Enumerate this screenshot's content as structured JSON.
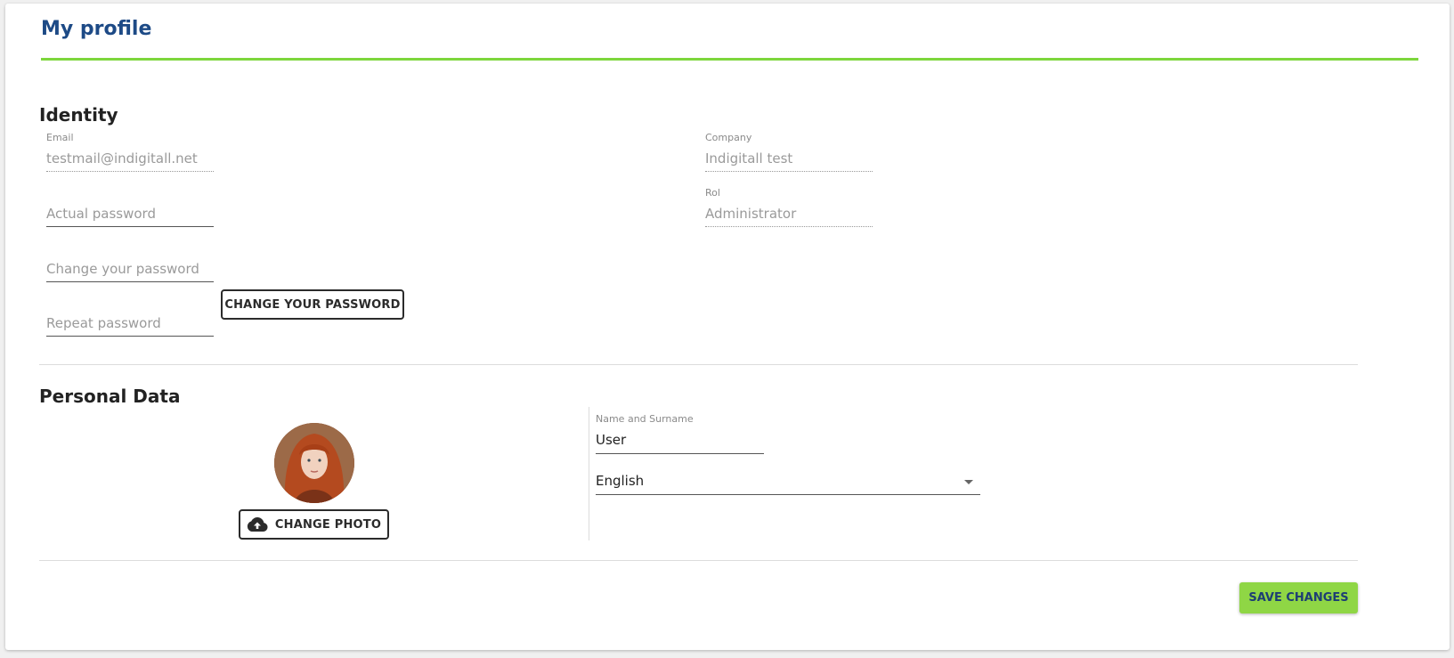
{
  "page": {
    "title": "My profile"
  },
  "identity": {
    "title": "Identity",
    "email": {
      "label": "Email",
      "value": "testmail@indigitall.net"
    },
    "actual_password": {
      "placeholder": "Actual password"
    },
    "change_password": {
      "placeholder": "Change your password"
    },
    "repeat_password": {
      "placeholder": "Repeat password"
    },
    "change_password_button": "CHANGE YOUR PASSWORD",
    "company": {
      "label": "Company",
      "value": "Indigitall test"
    },
    "rol": {
      "label": "Rol",
      "value": "Administrator"
    }
  },
  "personal": {
    "title": "Personal Data",
    "change_photo_button": "CHANGE PHOTO",
    "change_photo_icon": "cloud-upload-icon",
    "name": {
      "label": "Name and Surname",
      "value": "User"
    },
    "language": {
      "selected": "English"
    }
  },
  "footer": {
    "save_label": "SAVE CHANGES"
  },
  "colors": {
    "title": "#1d4a86",
    "accent": "#7dd63c",
    "save_button": "#8fd645"
  }
}
